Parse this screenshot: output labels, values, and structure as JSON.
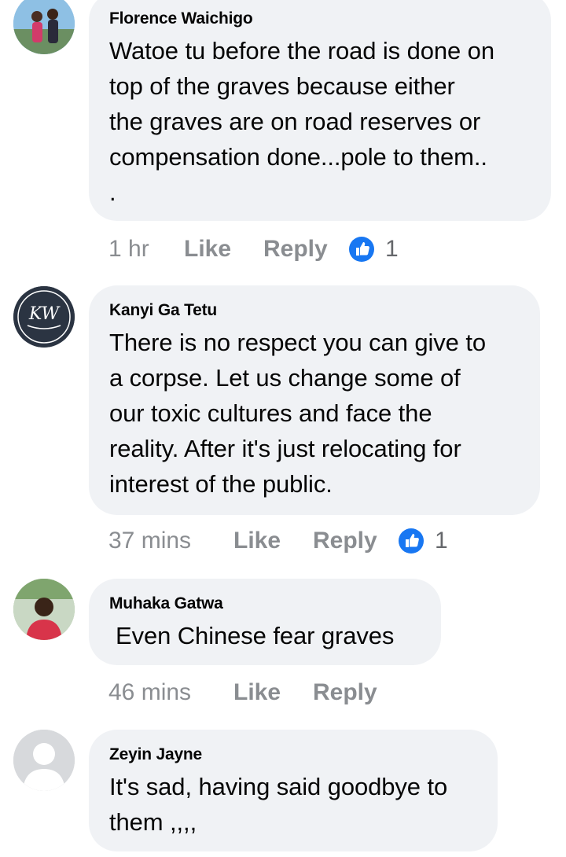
{
  "comments": [
    {
      "author": "Florence Waichigo",
      "text": "Watoe tu before the road is done on\ntop of the graves because either\nthe graves are on road reserves or\ncompensation done...pole to them..\n.",
      "time": "1 hr",
      "like_label": "Like",
      "reply_label": "Reply",
      "reaction_count": "1",
      "avatar_icon": "profile-photo"
    },
    {
      "author": "Kanyi Ga Tetu",
      "text": "There is no respect you can give to\na corpse. Let us change some of\nour toxic cultures and face the\nreality. After it's just relocating for\ninterest of the public.",
      "time": "37 mins",
      "like_label": "Like",
      "reply_label": "Reply",
      "reaction_count": "1",
      "avatar_icon": "kw-logo"
    },
    {
      "author": "Muhaka Gatwa",
      "text": "Even Chinese fear graves",
      "time": "46 mins",
      "like_label": "Like",
      "reply_label": "Reply",
      "avatar_icon": "profile-photo"
    },
    {
      "author": "Zeyin Jayne",
      "text": "It's sad, having said goodbye to\nthem ,,,,",
      "avatar_icon": "default-profile-silhouette"
    }
  ],
  "colors": {
    "bubble": "#f0f2f5",
    "meta_text": "#8a8d91",
    "like_blue": "#1877f2"
  }
}
